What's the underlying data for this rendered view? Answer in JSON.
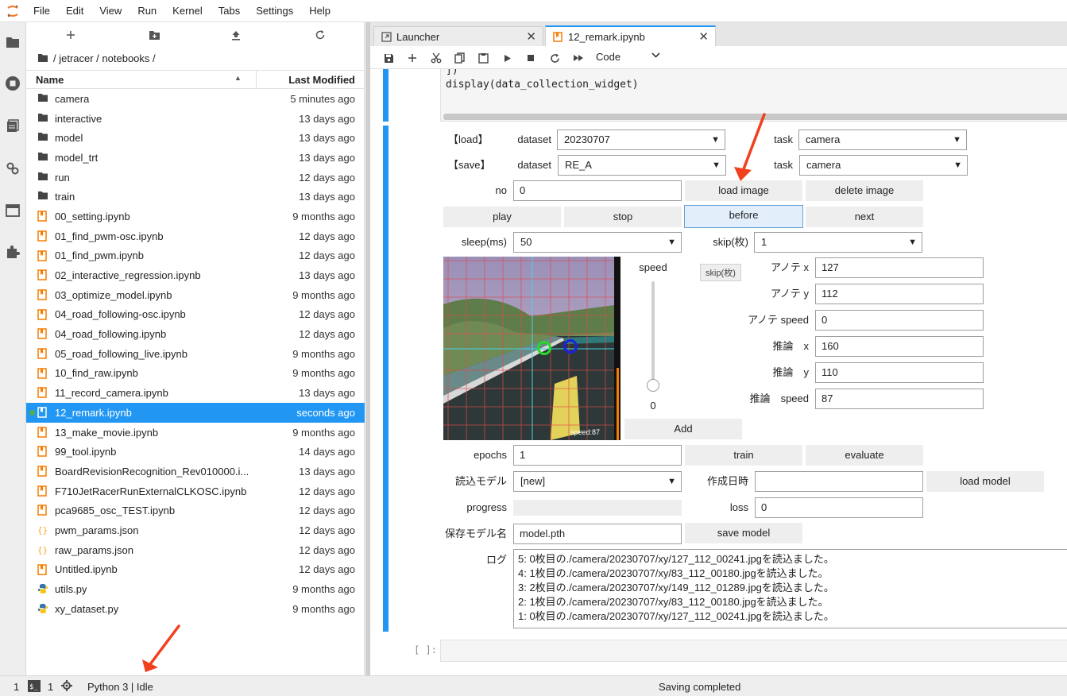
{
  "menubar": {
    "items": [
      "File",
      "Edit",
      "View",
      "Run",
      "Kernel",
      "Tabs",
      "Settings",
      "Help"
    ]
  },
  "activity_icons": [
    "folder-icon",
    "running-icon",
    "commands-icon",
    "property-inspector-icon",
    "tabs-icon",
    "extension-icon"
  ],
  "filebrowser": {
    "path": "/ jetracer / notebooks /",
    "header": {
      "name": "Name",
      "modified": "Last Modified"
    },
    "files": [
      {
        "name": "camera",
        "modified": "5 minutes ago",
        "type": "folder"
      },
      {
        "name": "interactive",
        "modified": "13 days ago",
        "type": "folder"
      },
      {
        "name": "model",
        "modified": "13 days ago",
        "type": "folder"
      },
      {
        "name": "model_trt",
        "modified": "13 days ago",
        "type": "folder"
      },
      {
        "name": "run",
        "modified": "12 days ago",
        "type": "folder"
      },
      {
        "name": "train",
        "modified": "13 days ago",
        "type": "folder"
      },
      {
        "name": "00_setting.ipynb",
        "modified": "9 months ago",
        "type": "notebook"
      },
      {
        "name": "01_find_pwm-osc.ipynb",
        "modified": "12 days ago",
        "type": "notebook"
      },
      {
        "name": "01_find_pwm.ipynb",
        "modified": "12 days ago",
        "type": "notebook"
      },
      {
        "name": "02_interactive_regression.ipynb",
        "modified": "13 days ago",
        "type": "notebook"
      },
      {
        "name": "03_optimize_model.ipynb",
        "modified": "9 months ago",
        "type": "notebook"
      },
      {
        "name": "04_road_following-osc.ipynb",
        "modified": "12 days ago",
        "type": "notebook"
      },
      {
        "name": "04_road_following.ipynb",
        "modified": "12 days ago",
        "type": "notebook"
      },
      {
        "name": "05_road_following_live.ipynb",
        "modified": "9 months ago",
        "type": "notebook"
      },
      {
        "name": "10_find_raw.ipynb",
        "modified": "9 months ago",
        "type": "notebook"
      },
      {
        "name": "11_record_camera.ipynb",
        "modified": "13 days ago",
        "type": "notebook"
      },
      {
        "name": "12_remark.ipynb",
        "modified": "seconds ago",
        "type": "notebook",
        "selected": true
      },
      {
        "name": "13_make_movie.ipynb",
        "modified": "9 months ago",
        "type": "notebook"
      },
      {
        "name": "99_tool.ipynb",
        "modified": "14 days ago",
        "type": "notebook"
      },
      {
        "name": "BoardRevisionRecognition_Rev010000.i...",
        "modified": "13 days ago",
        "type": "notebook"
      },
      {
        "name": "F710JetRacerRunExternalCLKOSC.ipynb",
        "modified": "12 days ago",
        "type": "notebook"
      },
      {
        "name": "pca9685_osc_TEST.ipynb",
        "modified": "12 days ago",
        "type": "notebook"
      },
      {
        "name": "pwm_params.json",
        "modified": "12 days ago",
        "type": "json"
      },
      {
        "name": "raw_params.json",
        "modified": "12 days ago",
        "type": "json"
      },
      {
        "name": "Untitled.ipynb",
        "modified": "12 days ago",
        "type": "notebook"
      },
      {
        "name": "utils.py",
        "modified": "9 months ago",
        "type": "python"
      },
      {
        "name": "xy_dataset.py",
        "modified": "9 months ago",
        "type": "python"
      }
    ]
  },
  "tabs": [
    {
      "label": "Launcher"
    },
    {
      "label": "12_remark.ipynb"
    }
  ],
  "notebook": {
    "cell_type": "Code",
    "code_lines": [
      "])",
      "display(data_collection_widget)"
    ],
    "load_label": "【load】",
    "save_label": "【save】",
    "dataset_label": "dataset",
    "task_label": "task",
    "load_dataset": "20230707",
    "load_task": "camera",
    "save_dataset": "RE_A",
    "save_task": "camera",
    "no_label": "no",
    "no_value": "0",
    "load_image_btn": "load image",
    "delete_image_btn": "delete image",
    "play_btn": "play",
    "stop_btn": "stop",
    "before_btn": "before",
    "next_btn": "next",
    "sleep_label": "sleep(ms)",
    "sleep_value": "50",
    "skip_label": "skip(枚)",
    "skip_value": "1",
    "tooltip": "skip(枚)",
    "speed_label": "speed",
    "speed_value": "0",
    "speed_overlay": "speed:87",
    "anno_x_label": "アノテ x",
    "anno_x": "127",
    "anno_y_label": "アノテ y",
    "anno_y": "112",
    "anno_speed_label": "アノテ speed",
    "anno_speed": "0",
    "pred_x_label": "推論　x",
    "pred_x": "160",
    "pred_y_label": "推論　y",
    "pred_y": "110",
    "pred_speed_label": "推論　speed",
    "pred_speed": "87",
    "add_btn": "Add",
    "epochs_label": "epochs",
    "epochs_value": "1",
    "train_btn": "train",
    "evaluate_btn": "evaluate",
    "model_label": "読込モデル",
    "model_value": "[new]",
    "created_label": "作成日時",
    "created_value": "",
    "load_model_btn": "load model",
    "progress_label": "progress",
    "progress_value": 0,
    "loss_label": "loss",
    "loss_value": "0",
    "save_model_label": "保存モデル名",
    "save_model_value": "model.pth",
    "save_model_btn": "save model",
    "log_label": "ログ",
    "log_lines": [
      "5: 0枚目の./camera/20230707/xy/127_112_00241.jpgを読込ました。",
      "4: 1枚目の./camera/20230707/xy/83_112_00180.jpgを読込ました。",
      "3: 2枚目の./camera/20230707/xy/149_112_01289.jpgを読込ました。",
      "2: 1枚目の./camera/20230707/xy/83_112_00180.jpgを読込ました。",
      "1: 0枚目の./camera/20230707/xy/127_112_00241.jpgを読込ました。"
    ],
    "empty_prompt": "[ ]:"
  },
  "statusbar": {
    "mode_count": "1",
    "terminal_count": "1",
    "kernel": "Python 3 | Idle",
    "message": "Saving completed"
  },
  "colors": {
    "accent": "#2196f3",
    "notebook_icon": "#f57c00",
    "annotation_arrow": "#f0401e"
  }
}
